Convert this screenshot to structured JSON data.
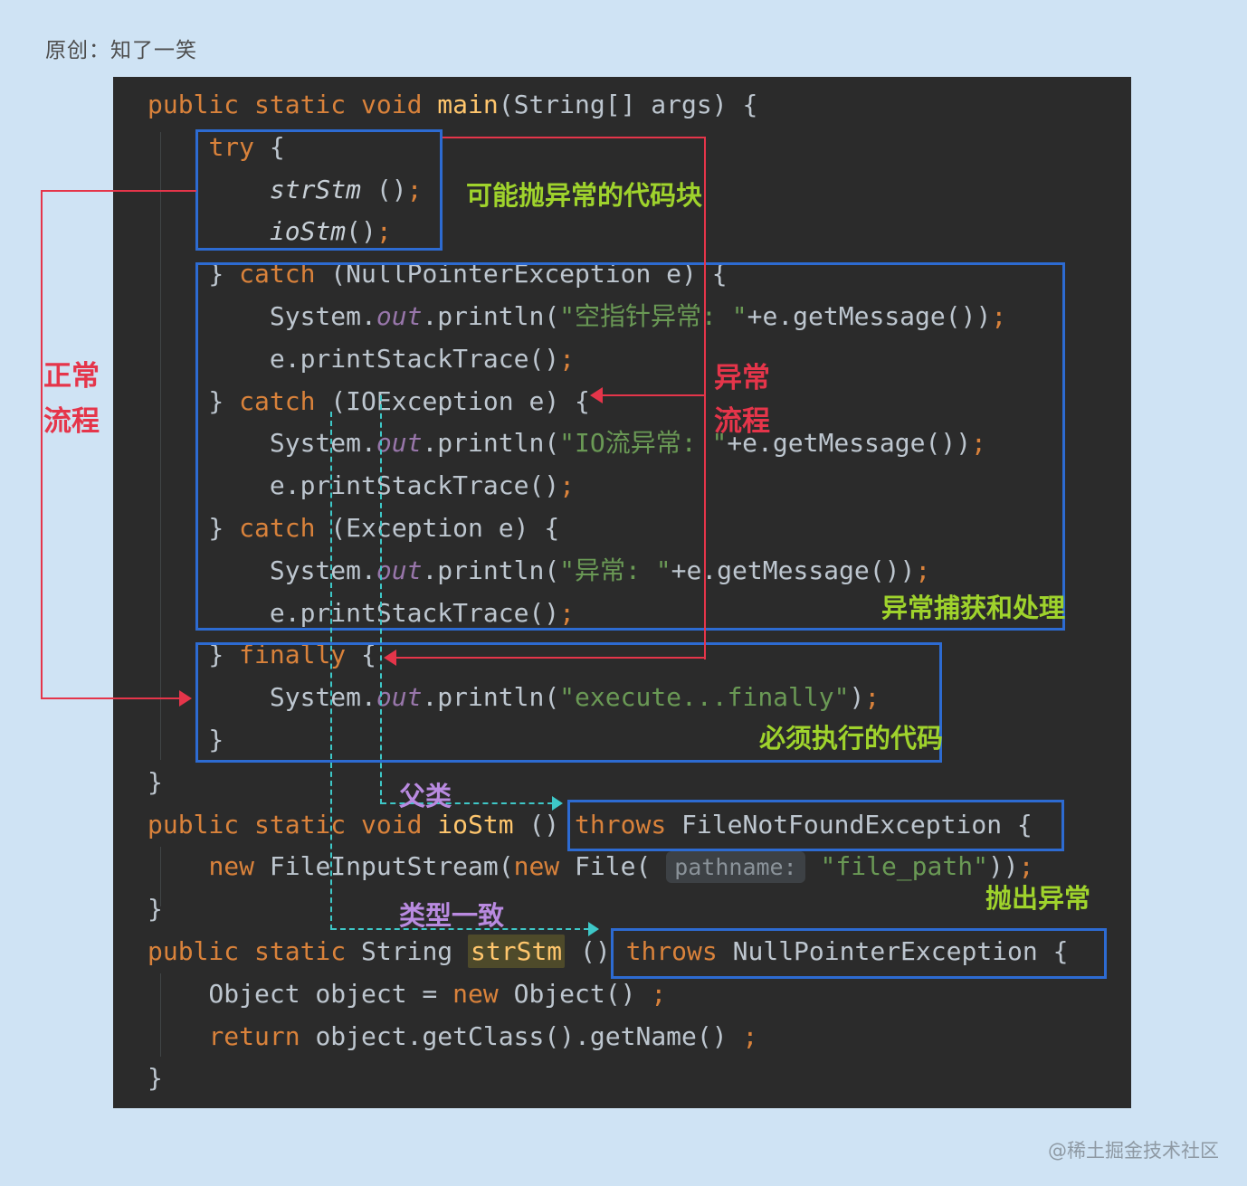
{
  "header": {
    "origin": "原创：知了一笑"
  },
  "footer": {
    "credit": "@稀土掘金技术社区"
  },
  "colors": {
    "red": "#e5354a",
    "blue": "#2d6bd2",
    "teal": "#3ec8c8",
    "green": "#9fd32c",
    "purple": "#b98ae0",
    "panel": "#2b2b2b",
    "page": "#cfe3f4"
  },
  "annotations": {
    "normal_flow_1": "正常",
    "normal_flow_2": "流程",
    "exception_flow_1": "异常",
    "exception_flow_2": "流程",
    "try_label": "可能抛异常的代码块",
    "catch_label": "异常捕获和处理",
    "finally_label": "必须执行的代码",
    "throw_label": "抛出异常",
    "parent_label": "父类",
    "type_label": "类型一致"
  },
  "code": {
    "lines": [
      [
        {
          "t": "public static void ",
          "c": "kw"
        },
        {
          "t": "main",
          "c": "fn"
        },
        {
          "t": "(String[] args) {",
          "c": "pl"
        }
      ],
      [
        {
          "t": "    ",
          "c": "pl"
        },
        {
          "t": "try",
          "c": "kw"
        },
        {
          "t": " {",
          "c": "pl"
        }
      ],
      [
        {
          "t": "        ",
          "c": "pl"
        },
        {
          "t": "strStm",
          "c": "it"
        },
        {
          "t": " ()",
          "c": "pl"
        },
        {
          "t": ";",
          "c": "semi"
        }
      ],
      [
        {
          "t": "        ",
          "c": "pl"
        },
        {
          "t": "ioStm",
          "c": "it"
        },
        {
          "t": "()",
          "c": "pl"
        },
        {
          "t": ";",
          "c": "semi"
        }
      ],
      [
        {
          "t": "    } ",
          "c": "pl"
        },
        {
          "t": "catch",
          "c": "kw"
        },
        {
          "t": " (NullPointerException e) {",
          "c": "pl"
        }
      ],
      [
        {
          "t": "        System.",
          "c": "pl"
        },
        {
          "t": "out",
          "c": "fld"
        },
        {
          "t": ".println(",
          "c": "pl"
        },
        {
          "t": "\"空指针异常: \"",
          "c": "str"
        },
        {
          "t": "+e.getMessage())",
          "c": "pl"
        },
        {
          "t": ";",
          "c": "semi"
        }
      ],
      [
        {
          "t": "        e.printStackTrace()",
          "c": "pl"
        },
        {
          "t": ";",
          "c": "semi"
        }
      ],
      [
        {
          "t": "    } ",
          "c": "pl"
        },
        {
          "t": "catch",
          "c": "kw"
        },
        {
          "t": " (IOException e) {",
          "c": "pl"
        }
      ],
      [
        {
          "t": "        System.",
          "c": "pl"
        },
        {
          "t": "out",
          "c": "fld"
        },
        {
          "t": ".println(",
          "c": "pl"
        },
        {
          "t": "\"IO流异常: \"",
          "c": "str"
        },
        {
          "t": "+e.getMessage())",
          "c": "pl"
        },
        {
          "t": ";",
          "c": "semi"
        }
      ],
      [
        {
          "t": "        e.printStackTrace()",
          "c": "pl"
        },
        {
          "t": ";",
          "c": "semi"
        }
      ],
      [
        {
          "t": "    } ",
          "c": "pl"
        },
        {
          "t": "catch",
          "c": "kw"
        },
        {
          "t": " (Exception e) {",
          "c": "pl"
        }
      ],
      [
        {
          "t": "        System.",
          "c": "pl"
        },
        {
          "t": "out",
          "c": "fld"
        },
        {
          "t": ".println(",
          "c": "pl"
        },
        {
          "t": "\"异常: \"",
          "c": "str"
        },
        {
          "t": "+e.getMessage())",
          "c": "pl"
        },
        {
          "t": ";",
          "c": "semi"
        }
      ],
      [
        {
          "t": "        e.printStackTrace()",
          "c": "pl"
        },
        {
          "t": ";",
          "c": "semi"
        }
      ],
      [
        {
          "t": "    } ",
          "c": "pl"
        },
        {
          "t": "finally",
          "c": "kw"
        },
        {
          "t": " {",
          "c": "pl"
        }
      ],
      [
        {
          "t": "        System.",
          "c": "pl"
        },
        {
          "t": "out",
          "c": "fld"
        },
        {
          "t": ".println(",
          "c": "pl"
        },
        {
          "t": "\"execute...finally\"",
          "c": "str"
        },
        {
          "t": ")",
          "c": "pl"
        },
        {
          "t": ";",
          "c": "semi"
        }
      ],
      [
        {
          "t": "    }",
          "c": "pl"
        }
      ],
      [
        {
          "t": "}",
          "c": "pl"
        }
      ],
      [
        {
          "t": "public static void ",
          "c": "kw"
        },
        {
          "t": "ioStm",
          "c": "fn"
        },
        {
          "t": " () ",
          "c": "pl"
        },
        {
          "t": "throws",
          "c": "kw"
        },
        {
          "t": " FileNotFoundException {",
          "c": "pl"
        }
      ],
      [
        {
          "t": "    ",
          "c": "pl"
        },
        {
          "t": "new",
          "c": "kw"
        },
        {
          "t": " FileInputStream(",
          "c": "pl"
        },
        {
          "t": "new",
          "c": "kw"
        },
        {
          "t": " File( ",
          "c": "pl"
        },
        {
          "t": "pathname:",
          "c": "hint"
        },
        {
          "t": " ",
          "c": "pl"
        },
        {
          "t": "\"file_path\"",
          "c": "str"
        },
        {
          "t": "))",
          "c": "pl"
        },
        {
          "t": ";",
          "c": "semi"
        }
      ],
      [
        {
          "t": "}",
          "c": "pl"
        }
      ],
      [
        {
          "t": "public static",
          "c": "kw"
        },
        {
          "t": " String ",
          "c": "pl"
        },
        {
          "t": "strStm",
          "c": "hl"
        },
        {
          "t": " () ",
          "c": "pl"
        },
        {
          "t": "throws",
          "c": "kw"
        },
        {
          "t": " NullPointerException {",
          "c": "pl"
        }
      ],
      [
        {
          "t": "    Object object = ",
          "c": "pl"
        },
        {
          "t": "new",
          "c": "kw"
        },
        {
          "t": " Object() ",
          "c": "pl"
        },
        {
          "t": ";",
          "c": "semi"
        }
      ],
      [
        {
          "t": "    ",
          "c": "pl"
        },
        {
          "t": "return",
          "c": "kw"
        },
        {
          "t": " object.getClass().getName() ",
          "c": "pl"
        },
        {
          "t": ";",
          "c": "semi"
        }
      ],
      [
        {
          "t": "}",
          "c": "pl"
        }
      ]
    ]
  }
}
